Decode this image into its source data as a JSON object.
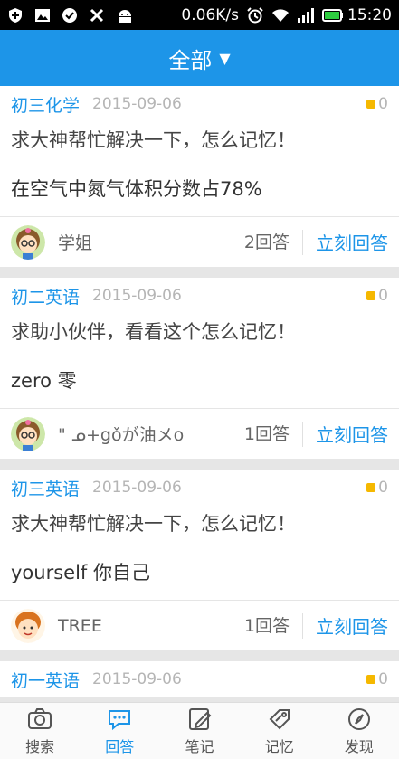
{
  "status_bar": {
    "speed": "0.06K/s",
    "time": "15:20",
    "icons": [
      "shield-icon",
      "image-icon",
      "check-icon",
      "tools-icon",
      "android-icon",
      "alarm-icon",
      "wifi-icon",
      "signal-icon",
      "battery-icon"
    ]
  },
  "header": {
    "title": "全部",
    "caret": "▼"
  },
  "questions": [
    {
      "subject": "初三化学",
      "date": "2015-09-06",
      "badge_count": "0",
      "question": "求大神帮忙解决一下，怎么记忆！",
      "content": "在空气中氮气体积分数占78%",
      "author": "学姐",
      "answer_count": "2回答",
      "reply_label": "立刻回答",
      "avatar": "girl-glasses-avatar"
    },
    {
      "subject": "初二英语",
      "date": "2015-09-06",
      "badge_count": "0",
      "question": "求助小伙伴，看看这个怎么记忆！",
      "content": "zero 零",
      "author": "\" ᓄ+gǒが油メo",
      "answer_count": "1回答",
      "reply_label": "立刻回答",
      "avatar": "girl-glasses-avatar"
    },
    {
      "subject": "初三英语",
      "date": "2015-09-06",
      "badge_count": "0",
      "question": "求大神帮忙解决一下，怎么记忆！",
      "content": "yourself 你自己",
      "author": "TREE",
      "answer_count": "1回答",
      "reply_label": "立刻回答",
      "avatar": "boy-avatar"
    },
    {
      "subject": "初一英语",
      "date": "2015-09-06",
      "badge_count": "0"
    }
  ],
  "tabs": [
    {
      "label": "搜索",
      "icon": "camera-icon",
      "active": false
    },
    {
      "label": "回答",
      "icon": "chat-icon",
      "active": true
    },
    {
      "label": "笔记",
      "icon": "note-icon",
      "active": false
    },
    {
      "label": "记忆",
      "icon": "tag-icon",
      "active": false
    },
    {
      "label": "发现",
      "icon": "compass-icon",
      "active": false
    }
  ],
  "colors": {
    "accent": "#1d95e8",
    "badge": "#f5b800"
  }
}
